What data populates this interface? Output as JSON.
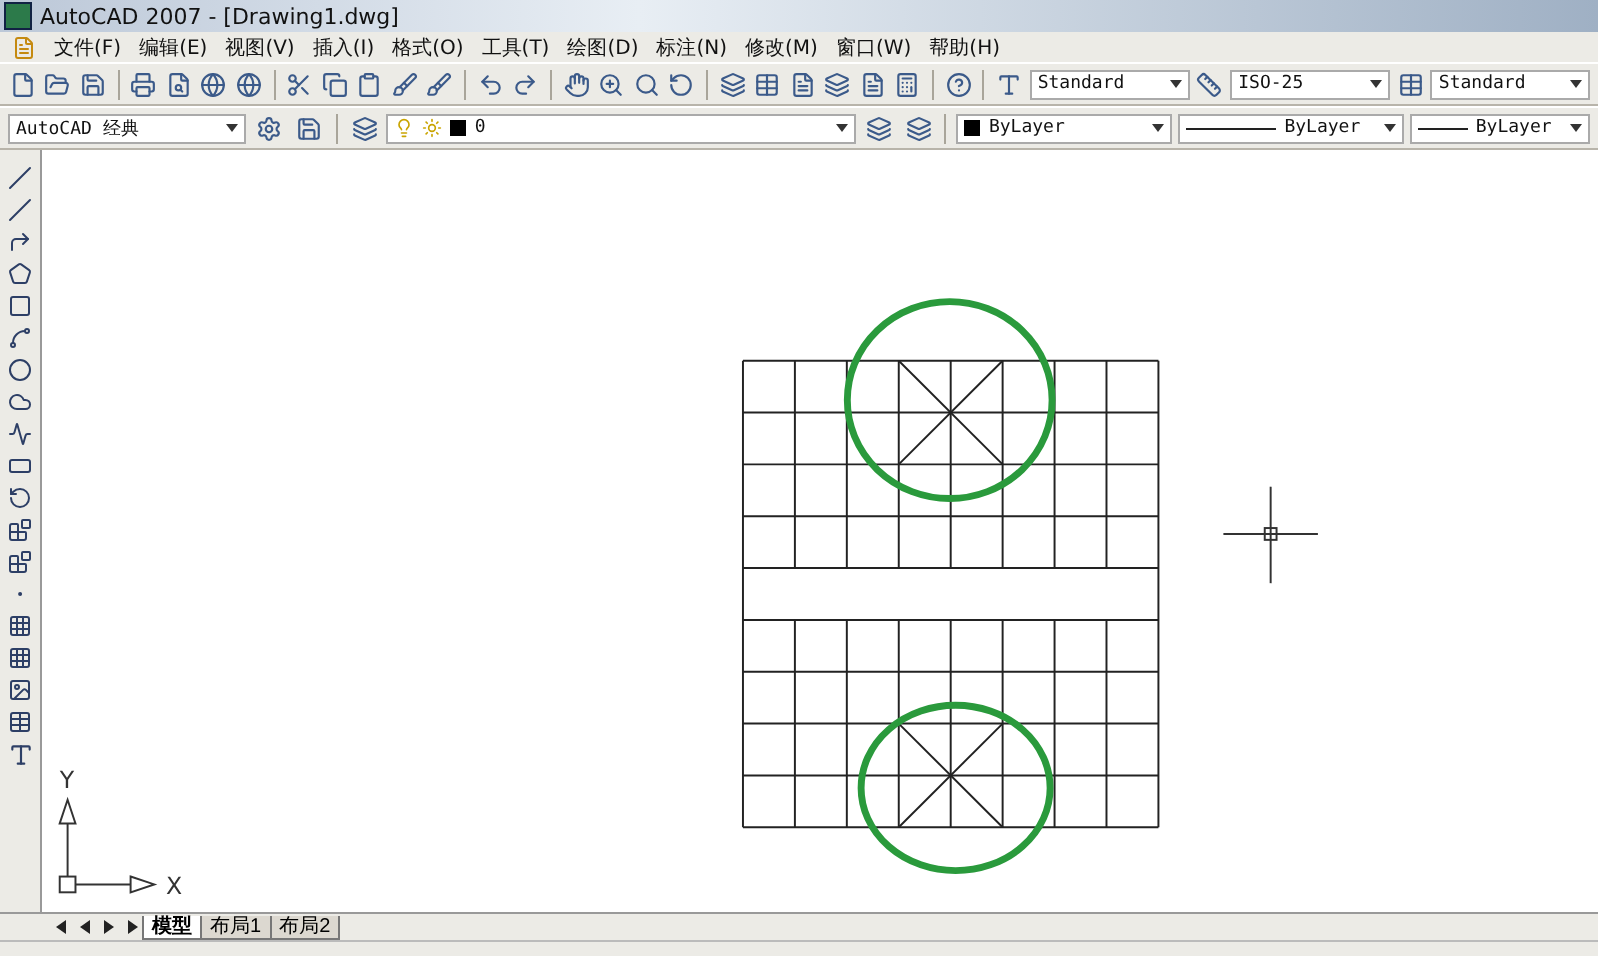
{
  "window": {
    "title": "AutoCAD 2007 - [Drawing1.dwg]"
  },
  "menu": [
    "文件(F)",
    "编辑(E)",
    "视图(V)",
    "插入(I)",
    "格式(O)",
    "工具(T)",
    "绘图(D)",
    "标注(N)",
    "修改(M)",
    "窗口(W)",
    "帮助(H)"
  ],
  "styles_toolbar": {
    "text_style": "Standard",
    "dim_style": "ISO-25",
    "table_style": "Standard"
  },
  "workspace": "AutoCAD 经典",
  "layer": "0",
  "properties": {
    "color_control": "ByLayer",
    "linetype": "ByLayer",
    "lineweight": "ByLayer"
  },
  "ucs": {
    "y_label": "Y",
    "x_label": "X"
  },
  "layout_tabs": [
    {
      "label": "模型",
      "selected": true
    },
    {
      "label": "布局1",
      "selected": false
    },
    {
      "label": "布局2",
      "selected": false
    }
  ]
}
